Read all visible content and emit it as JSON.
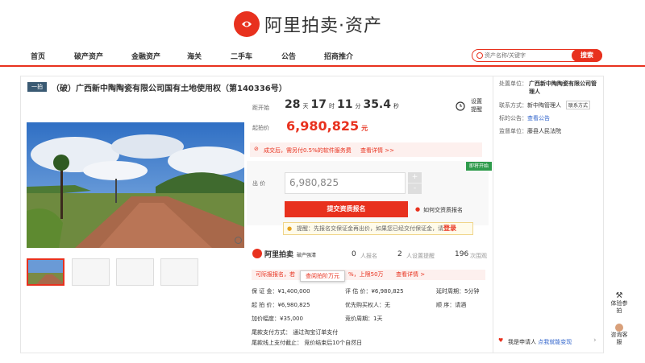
{
  "brand": {
    "name": "阿里拍卖·资产",
    "color": "#e8311e"
  },
  "nav": {
    "items": [
      "首页",
      "破产资产",
      "金融资产",
      "海关",
      "二手车",
      "公告",
      "招商推介"
    ]
  },
  "search": {
    "placeholder": "资产名称/关键字",
    "button": "搜索"
  },
  "lot": {
    "tag": "一拍",
    "title": "（破）广西新中陶陶瓷有限公司国有土地使用权（第140336号）",
    "countdown_label": "距开始",
    "days": "28",
    "days_unit": "天",
    "hours": "17",
    "hours_unit": "时",
    "minutes": "11",
    "minutes_unit": "分",
    "seconds": "35.4",
    "seconds_unit": "秒",
    "remind_label_1": "设置",
    "remind_label_2": "提醒",
    "start_price_label": "起拍价",
    "start_price": "6,980,825",
    "price_unit": "元",
    "fee_tip": "成交后，需另付0.5%的软件服务费",
    "fee_link": "查看详情 >>",
    "badge": "即将开始",
    "bid_label": "出  价",
    "bid_value": "6,980,825",
    "plus": "+",
    "minus": "-",
    "register_btn": "提交资质报名",
    "how_register": "如何交资质报名",
    "hint_text": "提醒：先报名交保证金再出价，如果您已经交付保证金，请",
    "hint_link": "登录"
  },
  "stats": {
    "brand_text": "阿里拍卖",
    "brand_sub": "破产强清",
    "apply_count": "0",
    "apply_label": "人报名",
    "remind_count": "2",
    "remind_label": "人设置提醒",
    "view_count": "196",
    "view_label": "次围观"
  },
  "alert": {
    "text": "可际报报名，若",
    "tooltip": "查阅拍阶万元",
    "tail": "%，上限50万",
    "link": "查看详情 >"
  },
  "details": {
    "deposit": "保 证 金：¥1,400,000",
    "assess": "评 估 价：¥6,980,825",
    "cycle": "延时周期：5分钟",
    "start": "起 拍 价：¥6,980,825",
    "priority": "优先购买权人：无",
    "order": "顺    序：请酒",
    "step": "加价幅度：¥35,000",
    "period": "竞价周期：1天",
    "pay_way": "尾款支付方式：  通过淘宝订单支付",
    "pay_deadline": "尾款线上支付截止：  竞价结束后10个自然日"
  },
  "side": {
    "supervisor_label": "处置单位：",
    "supervisor_value": "广西新中陶陶瓷有限公司管理人",
    "contact_label": "联系方式：",
    "contact_value": "新中陶管理人",
    "contact_btn": "联系方式",
    "notice_label": "标的公告：",
    "notice_link": "查看公告",
    "court_label": "监督单位：",
    "court_value": "藤县人民法院",
    "applicant": "我是申请人",
    "applicant_link": "点我就能变现"
  },
  "float": {
    "exp": "体验参拍",
    "consult": "咨询客服"
  }
}
